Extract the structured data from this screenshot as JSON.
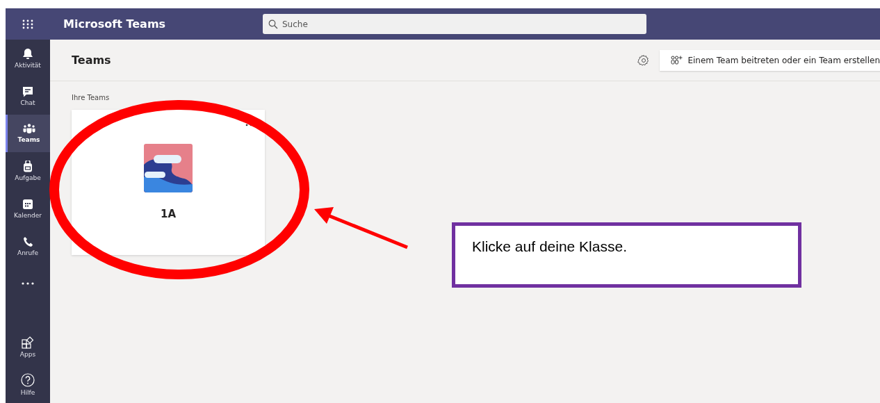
{
  "app_bar": {
    "title": "Microsoft Teams",
    "search": {
      "placeholder": "Suche"
    }
  },
  "nav": {
    "items": [
      {
        "kind": "bell",
        "label": "Aktivität",
        "selected": false
      },
      {
        "kind": "chat",
        "label": "Chat",
        "selected": false
      },
      {
        "kind": "teams",
        "label": "Teams",
        "selected": true
      },
      {
        "kind": "bag",
        "label": "Aufgabe",
        "selected": false
      },
      {
        "kind": "calendar",
        "label": "Kalender",
        "selected": false
      },
      {
        "kind": "phone",
        "label": "Anrufe",
        "selected": false
      },
      {
        "kind": "more",
        "selected": false
      }
    ],
    "bottom_items": [
      {
        "kind": "apps",
        "label": "Apps",
        "selected": false
      },
      {
        "kind": "help",
        "label": "Hilfe",
        "selected": false
      }
    ]
  },
  "page": {
    "title": "Teams",
    "join_button": "Einem Team beitreten oder ein Team erstellen",
    "section_label": "Ihre Teams",
    "teams": [
      {
        "name": "1A"
      }
    ]
  },
  "annotation": {
    "callout": "Klicke auf deine Klasse."
  }
}
